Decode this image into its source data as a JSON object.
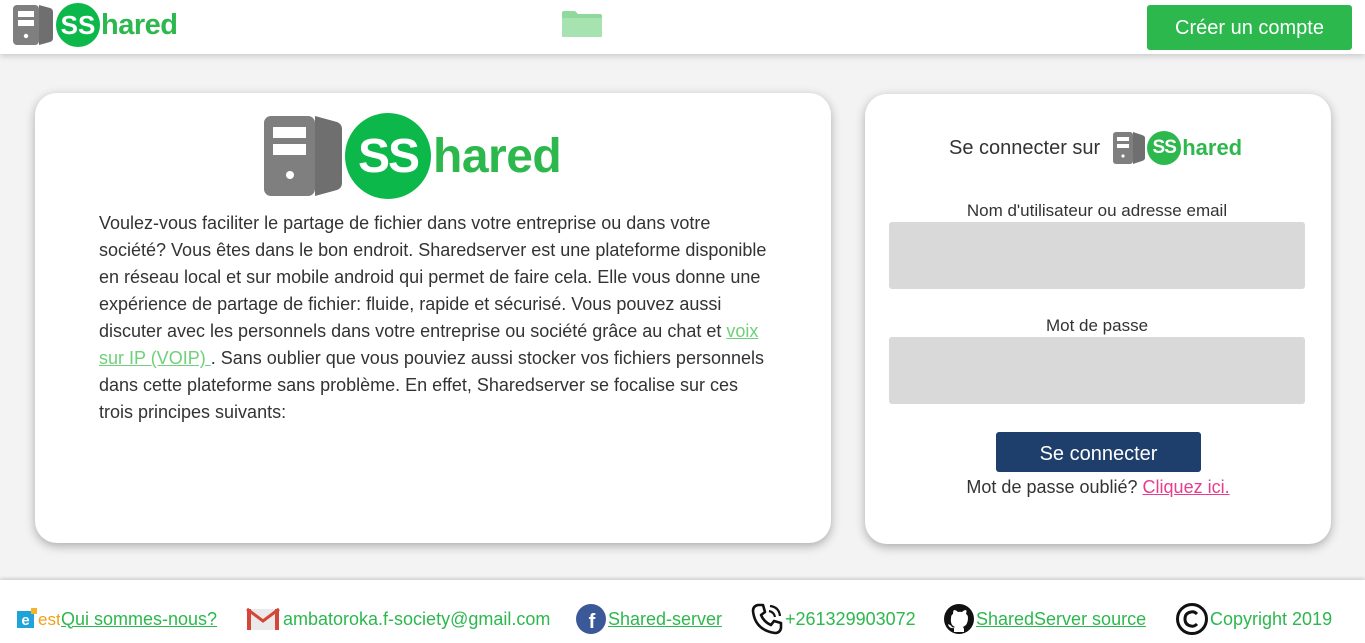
{
  "brand": {
    "logo_mark": "SS",
    "logo_rest": "hared",
    "green": "#2cb84d",
    "dark_blue": "#1e3f6b",
    "link_pink": "#e53d8f"
  },
  "header": {
    "folder_icon": "folder-icon",
    "create_account_label": "Créer un compte"
  },
  "intro": {
    "text_before": "Voulez-vous faciliter le partage de fichier dans votre entreprise ou dans votre société? Vous êtes dans le bon endroit. Sharedserver est une plateforme disponible en réseau local et sur mobile android qui permet de faire cela. Elle vous donne une expérience de partage de fichier: fluide, rapide et sécurisé. Vous pouvez aussi discuter avec les personnels dans votre entreprise ou société grâce au chat et ",
    "voip_link": "voix sur IP (VOIP) ",
    "text_after": ". Sans oublier que vous pouviez aussi stocker vos fichiers personnels dans cette plateforme sans problème. En effet, Sharedserver se focalise sur ces trois principes suivants:"
  },
  "login": {
    "title": "Se connecter sur",
    "username_label": "Nom d'utilisateur ou adresse email",
    "username_value": "",
    "password_label": "Mot de passe",
    "password_value": "",
    "submit_label": "Se connecter",
    "forgot_text": "Mot de passe oublié?",
    "forgot_link": "Cliquez ici."
  },
  "footer": {
    "about_logo": "esti",
    "about_link": "Qui sommes-nous?",
    "email": "ambatoroka.f-society@gmail.com",
    "facebook_link": "Shared-server",
    "phone": "+261329903072",
    "github_link": "SharedServer source",
    "copyright": "Copyright 2019"
  }
}
